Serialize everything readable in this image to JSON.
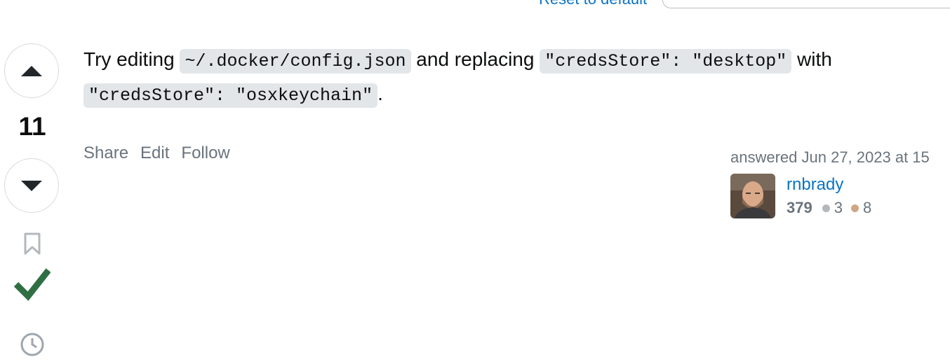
{
  "header": {
    "reset_link": "Reset to default"
  },
  "votes": {
    "score": "11",
    "upvote_icon": "triangle-up-icon",
    "downvote_icon": "triangle-down-icon",
    "bookmark_icon": "bookmark-icon",
    "accepted_icon": "checkmark-icon",
    "history_icon": "history-icon",
    "accepted_color": "#2f6f44"
  },
  "answer": {
    "text_1": "Try editing ",
    "code_1": "~/.docker/config.json",
    "text_2": " and replacing ",
    "code_2": "\"credsStore\": \"desktop\"",
    "text_3": " with",
    "code_3": "\"credsStore\": \"osxkeychain\"",
    "text_4": "."
  },
  "post_menu": {
    "share": "Share",
    "edit": "Edit",
    "follow": "Follow"
  },
  "user_card": {
    "action_time": "answered Jun 27, 2023 at 15",
    "user_name": "rnbrady",
    "reputation": "379",
    "silver_badges": "3",
    "bronze_badges": "8",
    "link_color": "#0a74c4"
  }
}
